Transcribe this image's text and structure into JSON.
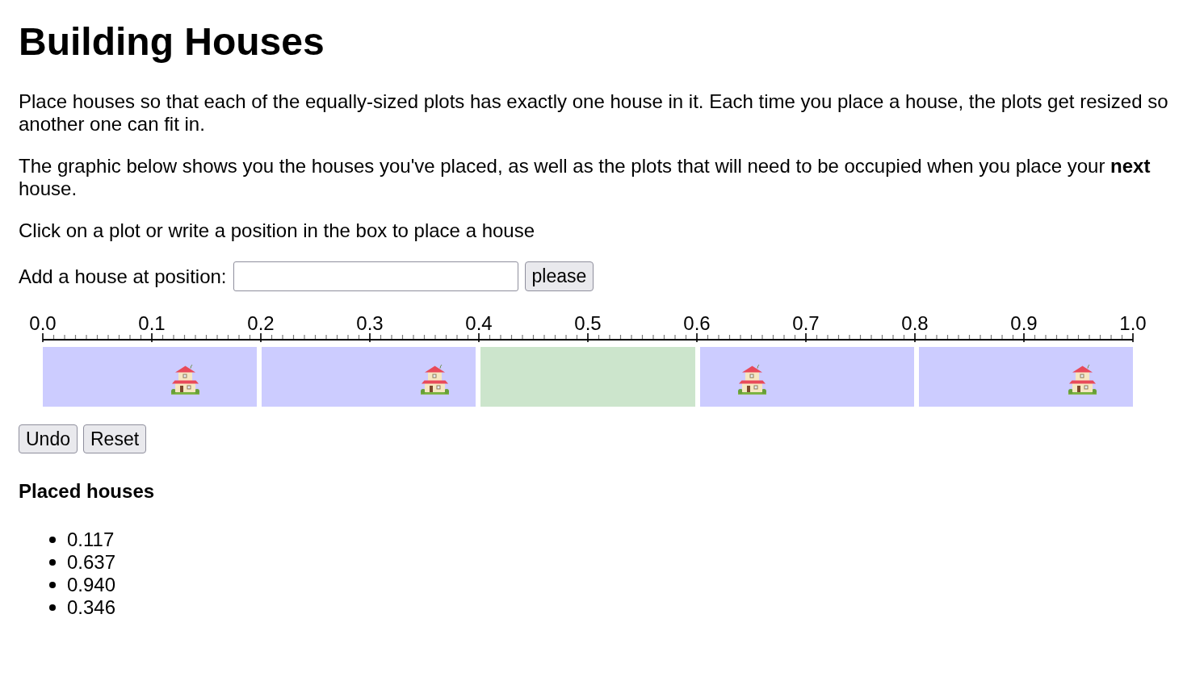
{
  "title": "Building Houses",
  "intro": [
    "Place houses so that each of the equally-sized plots has exactly one house in it. Each time you place a house, the plots get resized so another one can fit in.",
    "The graphic below shows you the houses you've placed, as well as the plots that will need to be occupied when you place your **next** house.",
    "Click on a plot or write a position in the box to place a house"
  ],
  "add_form": {
    "label": "Add a house at position:",
    "button": "please"
  },
  "number_line": {
    "ticks": [
      "0.0",
      "0.1",
      "0.2",
      "0.3",
      "0.4",
      "0.5",
      "0.6",
      "0.7",
      "0.8",
      "0.9",
      "1.0"
    ],
    "plots": [
      {
        "color": "#ccccff"
      },
      {
        "color": "#ccccff"
      },
      {
        "color": "#cce5cc"
      },
      {
        "color": "#ccccff"
      },
      {
        "color": "#ccccff"
      }
    ],
    "houses": [
      {
        "level": 0.117
      },
      {
        "level": 0.637
      },
      {
        "level": 0.94
      },
      {
        "level": 0.346
      }
    ]
  },
  "actions": [
    "Undo",
    "Reset"
  ],
  "placed_houses": {
    "heading": "Placed houses",
    "items": [
      "0.117",
      "0.637",
      "0.940",
      "0.346"
    ]
  }
}
